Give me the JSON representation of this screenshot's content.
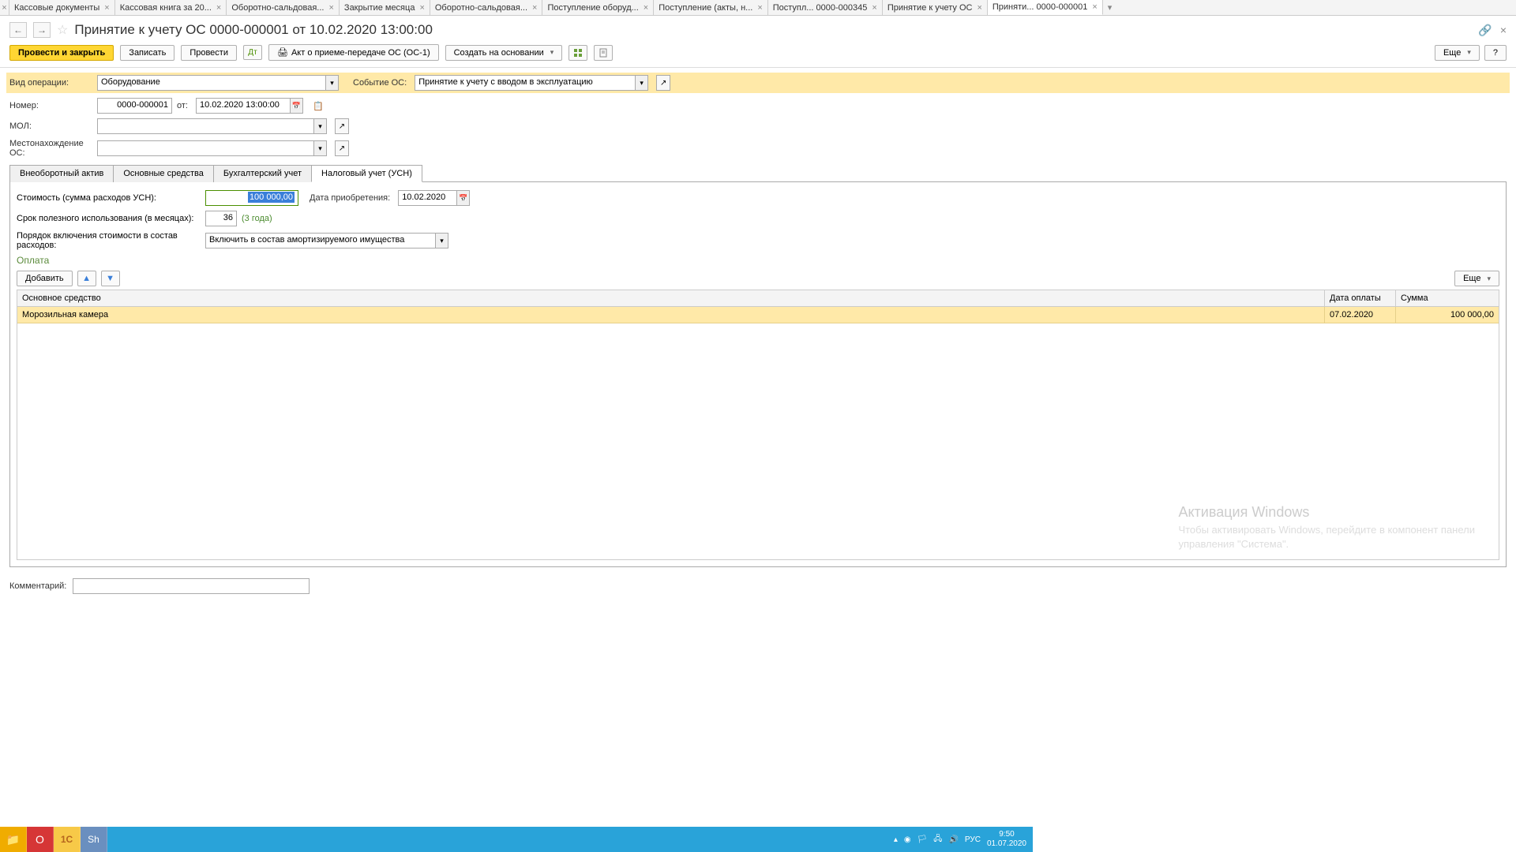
{
  "tabs": [
    {
      "label": "Кассовые документы"
    },
    {
      "label": "Кассовая книга за 20..."
    },
    {
      "label": "Оборотно-сальдовая..."
    },
    {
      "label": "Закрытие месяца"
    },
    {
      "label": "Оборотно-сальдовая..."
    },
    {
      "label": "Поступление оборуд..."
    },
    {
      "label": "Поступление (акты, н..."
    },
    {
      "label": "Поступл... 0000-000345"
    },
    {
      "label": "Принятие к учету ОС"
    },
    {
      "label": "Приняти... 0000-000001",
      "active": true
    }
  ],
  "title": "Принятие к учету ОС 0000-000001 от 10.02.2020 13:00:00",
  "toolbar": {
    "post_close": "Провести и закрыть",
    "save": "Записать",
    "post": "Провести",
    "print": "Акт о приеме-передаче ОС (ОС-1)",
    "create_based": "Создать на основании",
    "more": "Еще",
    "help": "?"
  },
  "form": {
    "op_type_label": "Вид операции:",
    "op_type_value": "Оборудование",
    "event_label": "Событие ОС:",
    "event_value": "Принятие к учету с вводом в эксплуатацию",
    "number_label": "Номер:",
    "number_value": "0000-000001",
    "date_label": "от:",
    "date_value": "10.02.2020 13:00:00",
    "mol_label": "МОЛ:",
    "mol_value": "",
    "location_label": "Местонахождение ОС:",
    "location_value": ""
  },
  "inner_tabs": [
    "Внеоборотный актив",
    "Основные средства",
    "Бухгалтерский учет",
    "Налоговый учет (УСН)"
  ],
  "tax": {
    "cost_label": "Стоимость (сумма расходов УСН):",
    "cost_value": "100 000,00",
    "acq_date_label": "Дата приобретения:",
    "acq_date_value": "10.02.2020",
    "useful_label": "Срок полезного использования (в месяцах):",
    "useful_value": "36",
    "useful_years": "(3 года)",
    "order_label": "Порядок включения стоимости в состав расходов:",
    "order_value": "Включить в состав амортизируемого имущества"
  },
  "payment": {
    "title": "Оплата",
    "add": "Добавить",
    "more": "Еще",
    "columns": {
      "asset": "Основное средство",
      "date": "Дата оплаты",
      "sum": "Сумма"
    },
    "rows": [
      {
        "asset": "Морозильная камера",
        "date": "07.02.2020",
        "sum": "100 000,00"
      }
    ]
  },
  "comment_label": "Комментарий:",
  "watermark": {
    "title": "Активация Windows",
    "line1": "Чтобы активировать Windows, перейдите в компонент панели",
    "line2": "управления \"Система\"."
  },
  "taskbar": {
    "lang": "РУС",
    "time": "9:50",
    "date": "01.07.2020"
  }
}
